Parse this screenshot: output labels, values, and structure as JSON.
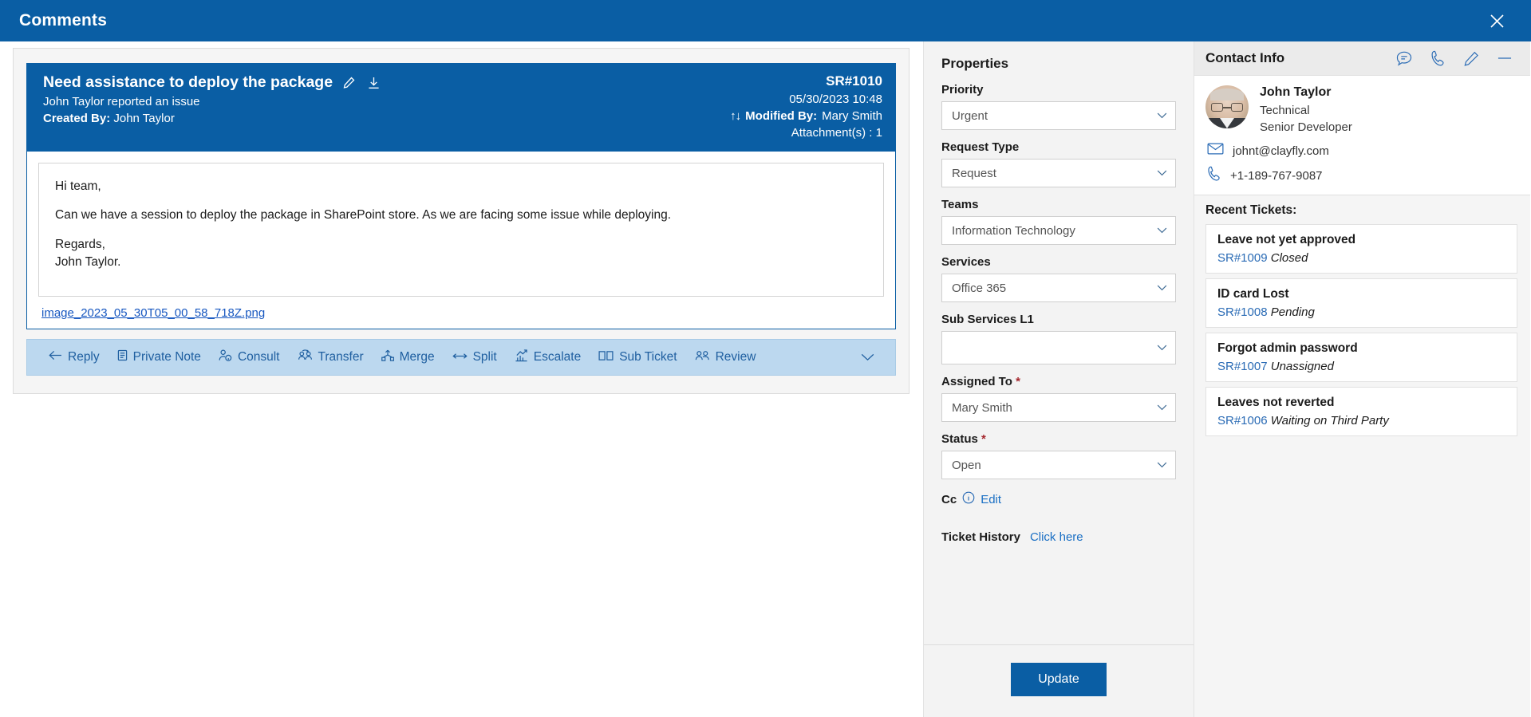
{
  "window": {
    "title": "Comments",
    "close_icon": "close-icon"
  },
  "ticket": {
    "title": "Need assistance to deploy the package",
    "edit_icon": "pencil-icon",
    "download_icon": "download-icon",
    "subtitle": "John Taylor reported an issue",
    "created_by_label": "Created By:",
    "created_by_value": "John Taylor",
    "sr_number": "SR#1010",
    "datetime": "05/30/2023 10:48",
    "sort_arrows": "↑↓",
    "modified_by_label": "Modified By:",
    "modified_by_value": "Mary Smith",
    "attachments_label": "Attachment(s) :",
    "attachments_count": "1",
    "message": {
      "greeting": "Hi team,",
      "body": "Can we have a session to deploy the package in SharePoint store. As we are facing some issue while deploying.",
      "signoff": "Regards,",
      "signature": "John Taylor."
    },
    "attachment_link": "image_2023_05_30T05_00_58_718Z.png"
  },
  "actions": [
    {
      "label": "Reply",
      "icon": "arrow-left-icon"
    },
    {
      "label": "Private Note",
      "icon": "note-icon"
    },
    {
      "label": "Consult",
      "icon": "person-info-icon"
    },
    {
      "label": "Transfer",
      "icon": "transfer-people-icon"
    },
    {
      "label": "Merge",
      "icon": "merge-icon"
    },
    {
      "label": "Split",
      "icon": "split-arrows-icon"
    },
    {
      "label": "Escalate",
      "icon": "chart-up-icon"
    },
    {
      "label": "Sub Ticket",
      "icon": "columns-icon"
    },
    {
      "label": "Review",
      "icon": "people-icon"
    }
  ],
  "actions_overflow_icon": "chevron-down-icon",
  "properties": {
    "heading": "Properties",
    "fields": [
      {
        "label": "Priority",
        "value": "Urgent",
        "required": false
      },
      {
        "label": "Request Type",
        "value": "Request",
        "required": false
      },
      {
        "label": "Teams",
        "value": "Information Technology",
        "required": false
      },
      {
        "label": "Services",
        "value": "Office 365",
        "required": false
      },
      {
        "label": "Sub Services L1",
        "value": "",
        "required": false
      },
      {
        "label": "Assigned To",
        "value": "Mary Smith",
        "required": true
      },
      {
        "label": "Status",
        "value": "Open",
        "required": true
      }
    ],
    "cc": {
      "label": "Cc",
      "info_icon": "info-circle-icon",
      "edit_link": "Edit"
    },
    "ticket_history": {
      "label": "Ticket History",
      "link": "Click here"
    },
    "update_button": "Update"
  },
  "contact": {
    "heading": "Contact Info",
    "header_icons": [
      {
        "name": "chat-icon"
      },
      {
        "name": "phone-icon"
      },
      {
        "name": "pencil-icon"
      },
      {
        "name": "minimize-icon"
      }
    ],
    "avatar_name": "avatar",
    "name": "John Taylor",
    "department": "Technical",
    "role": "Senior Developer",
    "email": "johnt@clayfly.com",
    "email_icon": "mail-icon",
    "phone": "+1-189-767-9087",
    "phone_icon": "phone-icon",
    "recent_title": "Recent Tickets:",
    "recent_tickets": [
      {
        "title": "Leave not yet approved",
        "id": "SR#1009",
        "status": "Closed"
      },
      {
        "title": "ID card Lost",
        "id": "SR#1008",
        "status": "Pending"
      },
      {
        "title": "Forgot admin password",
        "id": "SR#1007",
        "status": "Unassigned"
      },
      {
        "title": "Leaves not reverted",
        "id": "SR#1006",
        "status": "Waiting on Third Party"
      }
    ]
  },
  "colors": {
    "header_blue": "#0a5ea4",
    "action_bar_blue": "#bcd8ef",
    "link_blue": "#1a6fc4",
    "required_red": "#a4262c"
  }
}
